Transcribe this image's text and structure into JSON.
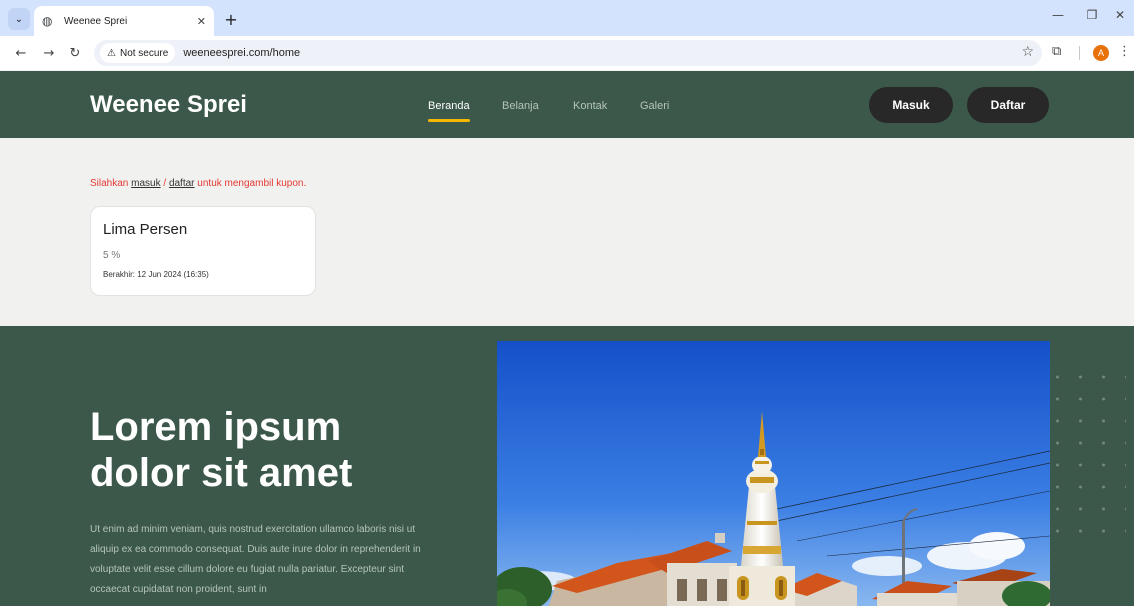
{
  "browser": {
    "tab_title": "Weenee Sprei",
    "security_label": "Not secure",
    "url": "weeneesprei.com/home",
    "profile_initial": "A"
  },
  "site": {
    "brand": "Weenee Sprei",
    "nav": [
      "Beranda",
      "Belanja",
      "Kontak",
      "Galeri"
    ],
    "active_nav": "Beranda",
    "login_label": "Masuk",
    "register_label": "Daftar",
    "colors": {
      "primary": "#3b584a",
      "accent": "#f4b800",
      "dark_button": "#282828",
      "notice_red": "#e53935"
    }
  },
  "notice": {
    "prefix": "Silahkan ",
    "login_link": "masuk",
    "separator": " / ",
    "register_link": "daftar",
    "suffix": " untuk mengambil kupon."
  },
  "coupon": {
    "title": "Lima Persen",
    "value": "5 %",
    "expiry": "Berakhir: 12 Jun 2024 (16:35)"
  },
  "hero": {
    "title": "Lorem ipsum dolor sit amet",
    "body": "Ut enim ad minim veniam, quis nostrud exercitation ullamco laboris nisi ut aliquip ex ea commodo consequat. Duis aute irure dolor in reprehenderit in voluptate velit esse cillum dolore eu fugiat nulla pariatur. Excepteur sint occaecat cupidatat non proident, sunt in"
  },
  "icons": [
    "tab-search-icon",
    "globe-icon",
    "close-icon",
    "plus-icon",
    "minimize-icon",
    "restore-icon",
    "back-icon",
    "forward-icon",
    "reload-icon",
    "warning-icon",
    "star-icon",
    "extensions-icon",
    "menu-icon"
  ]
}
